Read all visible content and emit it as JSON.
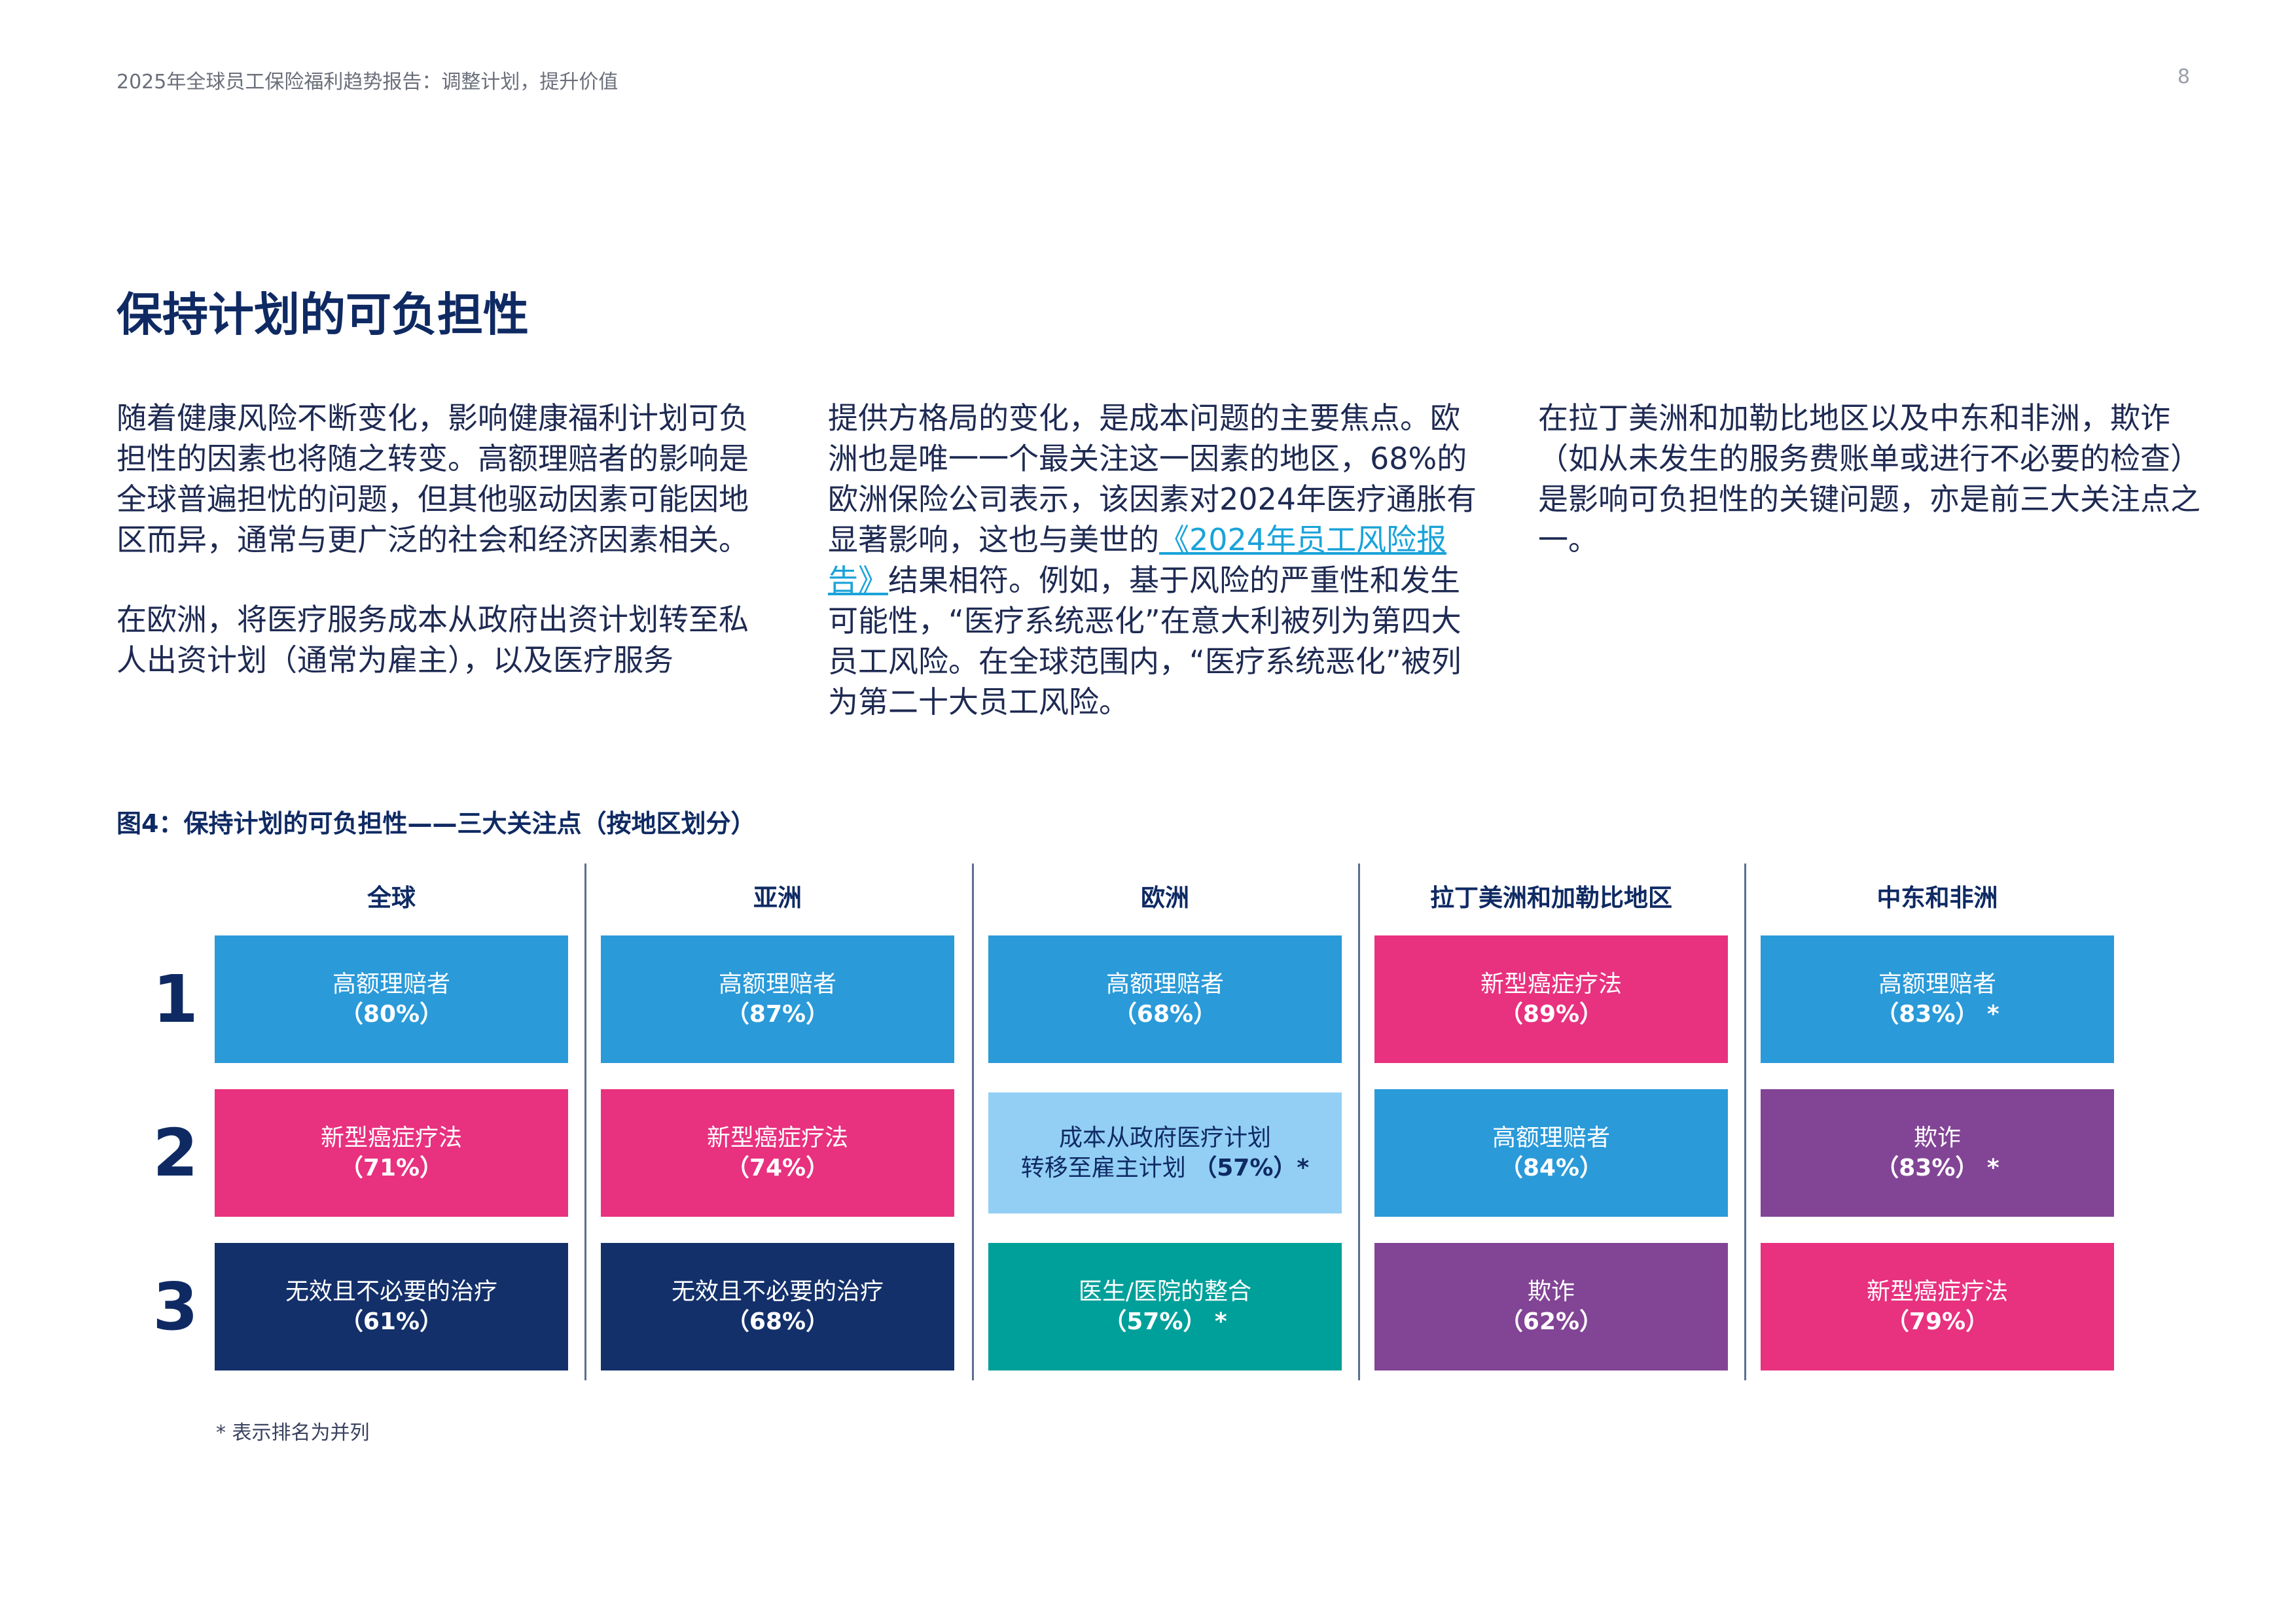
{
  "header": {
    "title": "2025年全球员工保险福利趋势报告：调整计划，提升价值",
    "page_number": "8"
  },
  "section_title": "保持计划的可负担性",
  "columns": {
    "col1_p1": "随着健康风险不断变化，影响健康福利计划可负担性的因素也将随之转变。高额理赔者的影响是全球普遍担忧的问题，但其他驱动因素可能因地区而异，通常与更广泛的社会和经济因素相关。",
    "col1_p2": "在欧洲，将医疗服务成本从政府出资计划转至私人出资计划（通常为雇主），以及医疗服务",
    "col2_pre": "提供方格局的变化，是成本问题的主要焦点。欧洲也是唯一一个最关注这一因素的地区，68%的欧洲保险公司表示，该因素对2024年医疗通胀有显著影响，这也与美世的",
    "col2_link": "《2024年员工风险报告》",
    "col2_post": "结果相符。例如，基于风险的严重性和发生可能性，“医疗系统恶化”在意大利被列为第四大员工风险。在全球范围内，“医疗系统恶化”被列为第二十大员工风险。",
    "col3_p1": "在拉丁美洲和加勒比地区以及中东和非洲，欺诈（如从未发生的服务费账单或进行不必要的检查）是影响可负担性的关键问题，亦是前三大关注点之一。"
  },
  "figure_title": "图4：保持计划的可负担性——三大关注点（按地区划分）",
  "chart_data": {
    "type": "table",
    "ranks": [
      "1",
      "2",
      "3"
    ],
    "regions": [
      {
        "name": "全球",
        "items": [
          {
            "label": "高额理赔者",
            "pct": "（80%）",
            "color": "#2a9ad9"
          },
          {
            "label": "新型癌症疗法",
            "pct": "（71%）",
            "color": "#e8317f"
          },
          {
            "label": "无效且不必要的治疗",
            "pct": "（61%）",
            "color": "#13306a"
          }
        ]
      },
      {
        "name": "亚洲",
        "items": [
          {
            "label": "高额理赔者",
            "pct": "（87%）",
            "color": "#2a9ad9"
          },
          {
            "label": "新型癌症疗法",
            "pct": "（74%）",
            "color": "#e8317f"
          },
          {
            "label": "无效且不必要的治疗",
            "pct": "（68%）",
            "color": "#13306a"
          }
        ]
      },
      {
        "name": "欧洲",
        "items": [
          {
            "label": "高额理赔者",
            "pct": "（68%）",
            "color": "#2a9ad9"
          },
          {
            "label": "成本从政府医疗计划",
            "label2": "转移至雇主计划 ",
            "pct": "（57%）*",
            "color": "#93cff5",
            "dark": true
          },
          {
            "label": "医生/医院的整合",
            "pct": "（57%） *",
            "color": "#00a09a"
          }
        ]
      },
      {
        "name": "拉丁美洲和加勒比地区",
        "items": [
          {
            "label": "新型癌症疗法",
            "pct": "（89%）",
            "color": "#e8317f"
          },
          {
            "label": "高额理赔者",
            "pct": "（84%）",
            "color": "#2a9ad9"
          },
          {
            "label": "欺诈",
            "pct": "（62%）",
            "color": "#824495"
          }
        ]
      },
      {
        "name": "中东和非洲",
        "items": [
          {
            "label": "高额理赔者",
            "pct": "（83%） *",
            "color": "#2a9ad9"
          },
          {
            "label": "欺诈",
            "pct": "（83%） *",
            "color": "#824495"
          },
          {
            "label": "新型癌症疗法",
            "pct": "（79%）",
            "color": "#e8317f"
          }
        ]
      }
    ]
  },
  "footnote": "* 表示排名为并列"
}
